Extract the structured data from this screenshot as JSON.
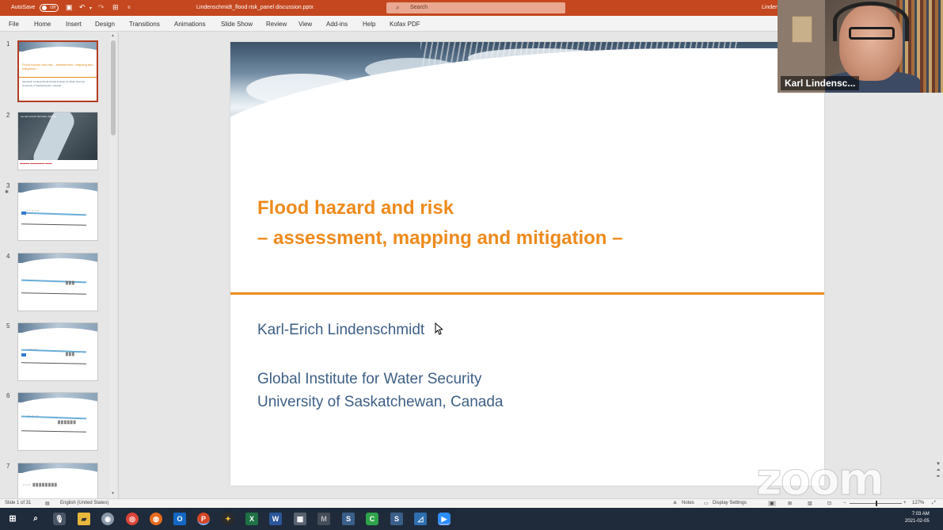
{
  "titlebar": {
    "autosave_label": "AutoSave",
    "autosave_state": "Off",
    "filename": "Lindenschmidt_flood risk_panel discussion.pptx",
    "search_placeholder": "Search",
    "user": "Linden"
  },
  "ribbon": {
    "tabs": [
      "File",
      "Home",
      "Insert",
      "Design",
      "Transitions",
      "Animations",
      "Slide Show",
      "Review",
      "View",
      "Add-ins",
      "Help",
      "Kofax PDF"
    ]
  },
  "thumbnails": {
    "numbers": [
      "1",
      "2",
      "3",
      "4",
      "5",
      "6",
      "7"
    ],
    "slide1_title": "Flood hazard and risk – assessment, mapping and mitigation –",
    "slide1_sub": "Karl-Erich Lindenschmidt Global Institute for Water Security University of Saskatchewan, Canada",
    "slide2_title": "Ice Jam at Fort Vermilion, Alberta"
  },
  "slide": {
    "title_line1": "Flood hazard and risk",
    "title_line2": "– assessment, mapping and mitigation –",
    "author": "Karl-Erich Lindenschmidt",
    "institute": "Global Institute for Water Security",
    "university": "University of Saskatchewan, Canada"
  },
  "webcam": {
    "participant_name": "Karl Lindensc..."
  },
  "watermark": "zoom",
  "statusbar": {
    "slide_count": "Slide 1 of 31",
    "language": "English (United States)",
    "notes": "Notes",
    "display_settings": "Display Settings",
    "zoom": "127%"
  },
  "taskbar": {
    "time": "7:03 AM",
    "date": "2021-02-05"
  },
  "colors": {
    "ppt_accent": "#c4471f",
    "slide_orange": "#ee8a1c",
    "slide_blue": "#3d5f86",
    "taskbar": "#1f2a3a"
  }
}
